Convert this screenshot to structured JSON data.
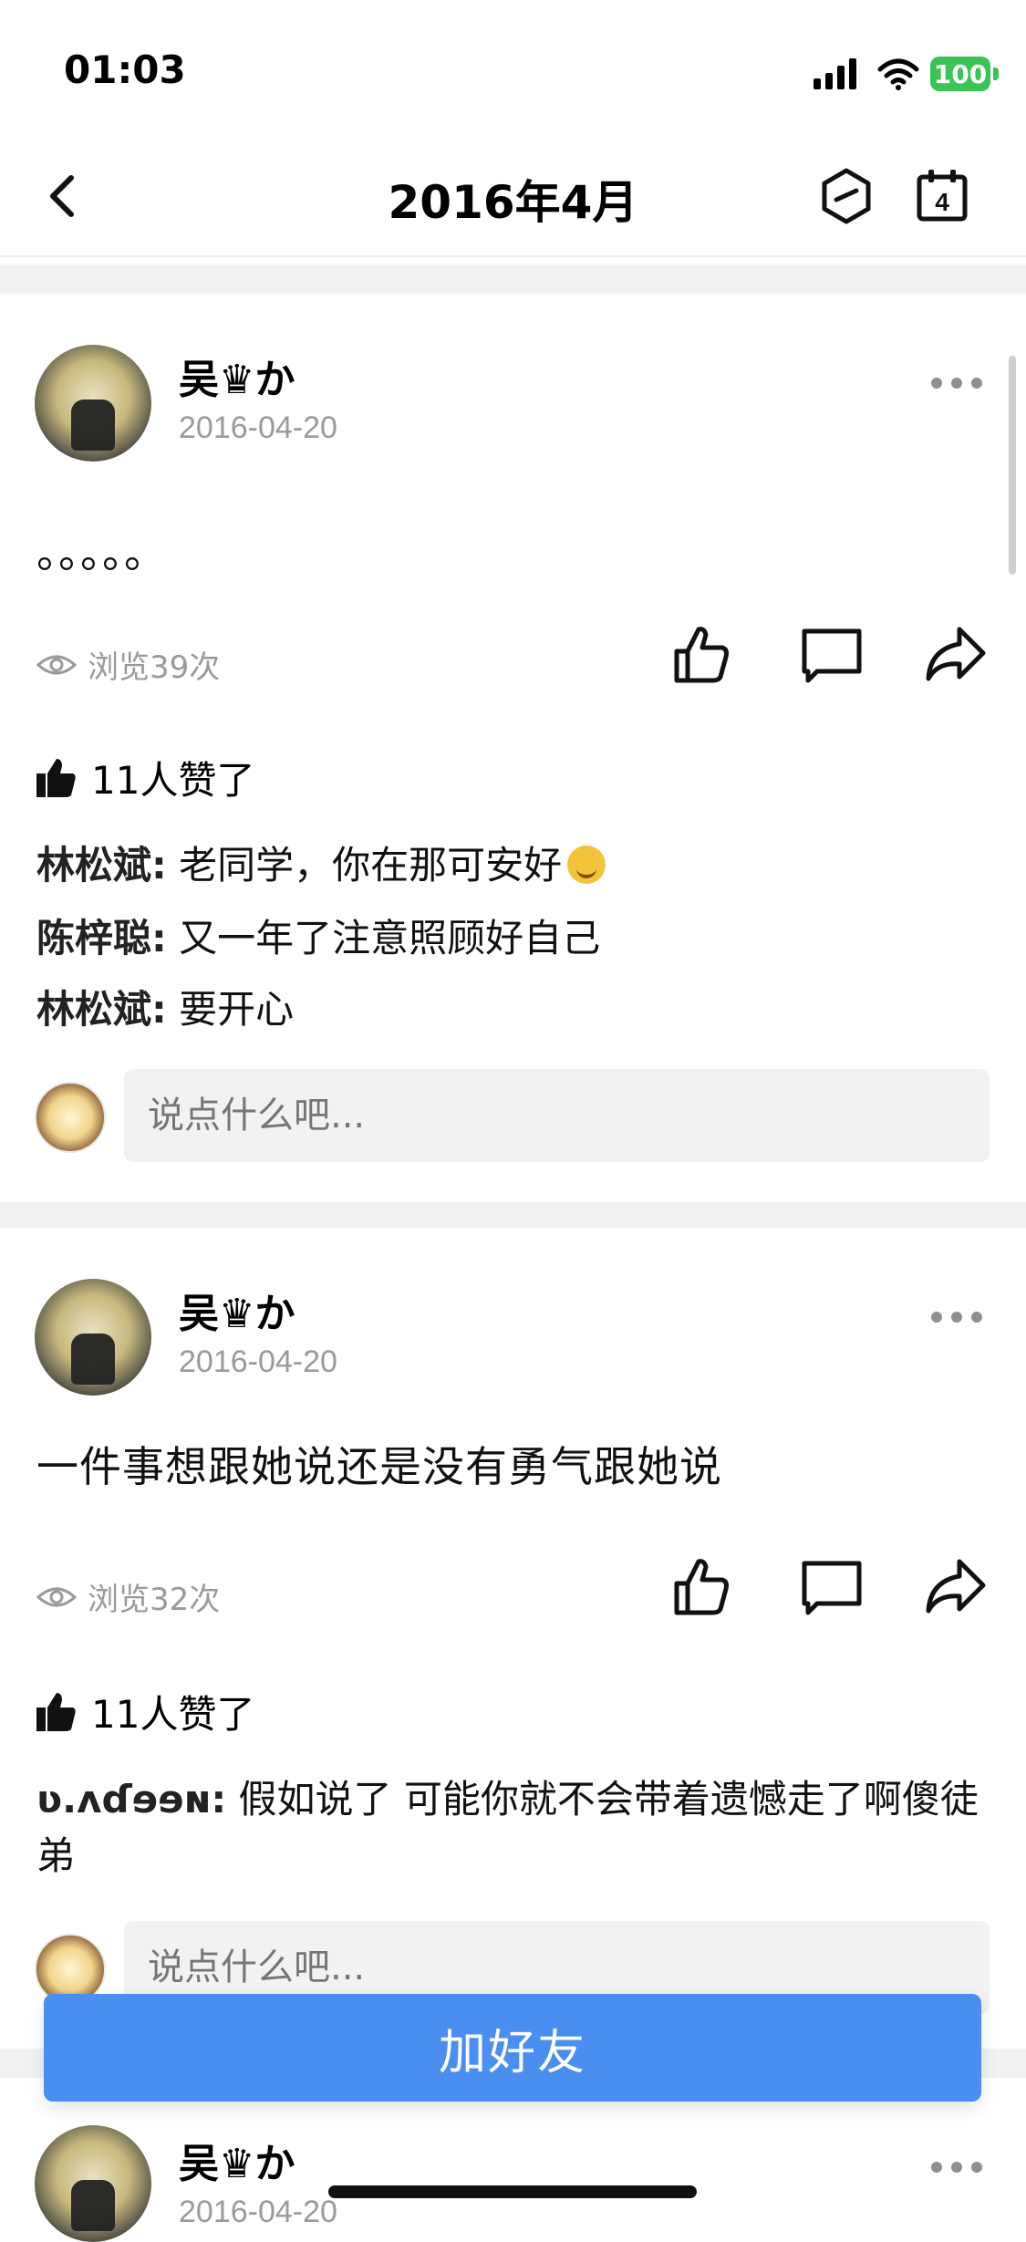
{
  "status": {
    "time": "01:03",
    "battery": "100"
  },
  "nav": {
    "title": "2016年4月",
    "calendar_day": "4"
  },
  "posts": [
    {
      "author": "吴♛か",
      "date": "2016-04-20",
      "content": "。。。。。",
      "views": "浏览39次",
      "likes": "11人赞了",
      "comments": [
        {
          "author": "林松斌:",
          "text": "老同学，你在那可安好"
        },
        {
          "author": "陈梓聪:",
          "text": "又一年了注意照顾好自己"
        },
        {
          "author": "林松斌:",
          "text": "要开心"
        }
      ],
      "comment_placeholder": "说点什么吧..."
    },
    {
      "author": "吴♛か",
      "date": "2016-04-20",
      "content": "一件事想跟她说还是没有勇气跟她说",
      "views": "浏览32次",
      "likes": "11人赞了",
      "comments": [
        {
          "author": "ʋ.ʌɗɘɘɴ:",
          "text": "假如说了 可能你就不会带着遗憾走了啊傻徒弟"
        }
      ],
      "comment_placeholder": "说点什么吧..."
    },
    {
      "author": "吴♛か",
      "date": "2016-04-20"
    }
  ],
  "actions": {
    "add_friend": "加好友"
  },
  "colors": {
    "accent": "#4a8ff0",
    "battery": "#3ac453",
    "separator": "#f2f2f2",
    "secondary_text": "#9a9a9a"
  }
}
